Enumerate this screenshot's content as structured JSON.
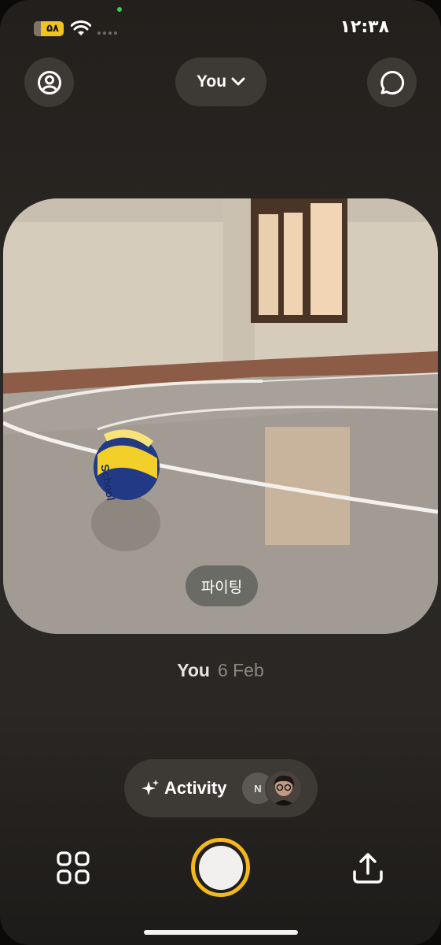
{
  "status_bar": {
    "battery": "۵۸",
    "time": "۱۲:۳۸"
  },
  "header": {
    "friend_selector": {
      "label": "You"
    }
  },
  "post": {
    "caption": "파이팅",
    "author": "You",
    "date": "6 Feb",
    "scene": "Volleyball on a polished court floor",
    "ball_text": "School"
  },
  "activity": {
    "label": "Activity",
    "avatar_initial": "N"
  },
  "bottom_bar": {
    "grid": "grid-icon",
    "shutter": "shutter-button",
    "share": "share-icon"
  },
  "colors": {
    "background": "#2a2623",
    "pill": "#3d3935",
    "accent": "#f2b81c",
    "battery": "#f2c31b"
  }
}
